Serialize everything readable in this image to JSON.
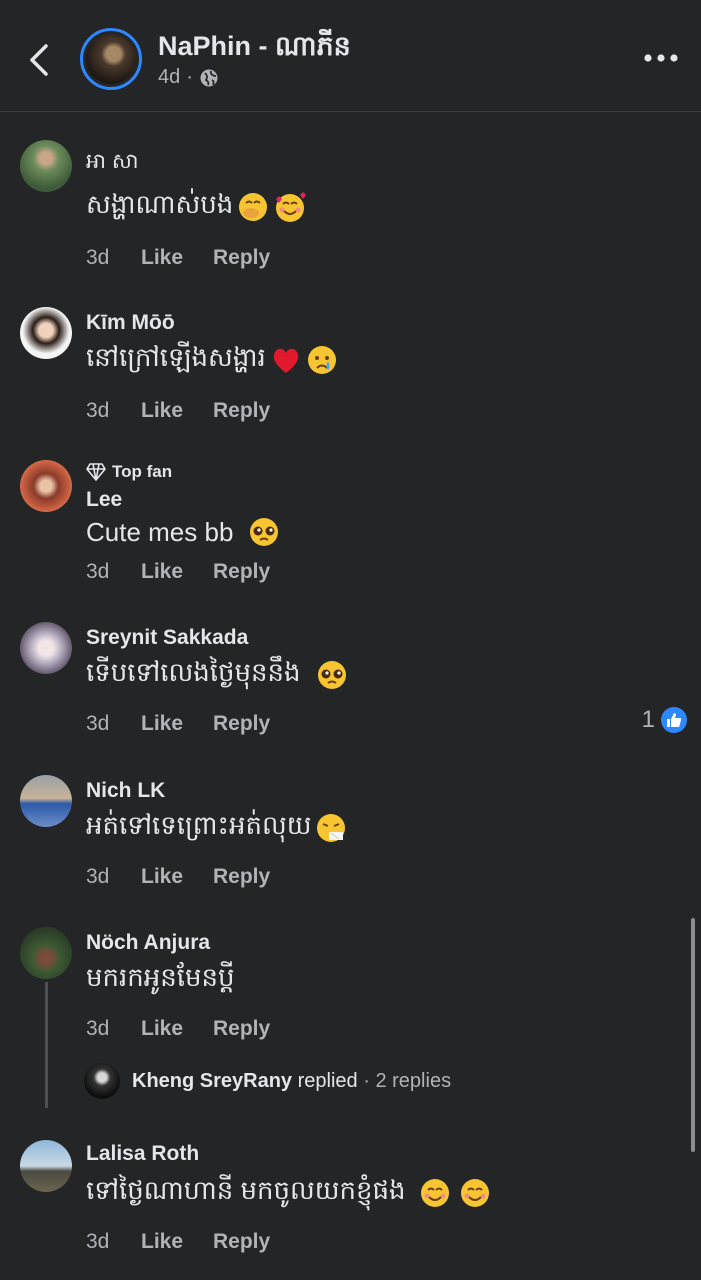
{
  "header": {
    "title": "NaPhin - ណាភីន",
    "age": "4d",
    "separator": "·",
    "back_icon": "chevron-left-icon",
    "privacy_icon": "globe-icon",
    "more_icon": "more-horizontal-icon"
  },
  "actions": {
    "like": "Like",
    "reply": "Reply"
  },
  "comments": [
    {
      "name": "អា សា",
      "text": "សង្ហាណាស់បង",
      "time": "3d",
      "emojis": [
        "face-hand-over-mouth",
        "smiling-face-with-hearts"
      ]
    },
    {
      "name": "Kīm Mōō",
      "text": "នៅក្រៅឡើងសង្ហារ",
      "time": "3d",
      "emojis": [
        "red-heart",
        "crying-face"
      ]
    },
    {
      "badge": "Top fan",
      "name": "Lee",
      "text": "Cute mes bb",
      "time": "3d",
      "emojis": [
        "pleading-face"
      ]
    },
    {
      "name": "Sreynit Sakkada",
      "text": "ទើបទៅលេងថ្ងៃមុននឹង",
      "time": "3d",
      "emojis": [
        "pleading-face"
      ],
      "reaction_count": "1"
    },
    {
      "name": "Nich LK",
      "text": "អត់ទៅទេព្រោះអត់លុយ",
      "time": "3d",
      "emojis": [
        "sneezing-face"
      ]
    },
    {
      "name": "Nöch Anjura",
      "text": "មករកអូនមែនប្តី",
      "time": "3d",
      "emojis": [],
      "reply_preview": {
        "name": "Kheng SreyRany",
        "replied": "replied",
        "dot": "·",
        "count": "2 replies"
      }
    },
    {
      "name": "Lalisa Roth",
      "text": "ទៅថ្ងៃណាហានី មកចូលយកខ្ញុំផង",
      "time": "3d",
      "emojis": [
        "smiling-face",
        "smiling-face"
      ]
    }
  ]
}
